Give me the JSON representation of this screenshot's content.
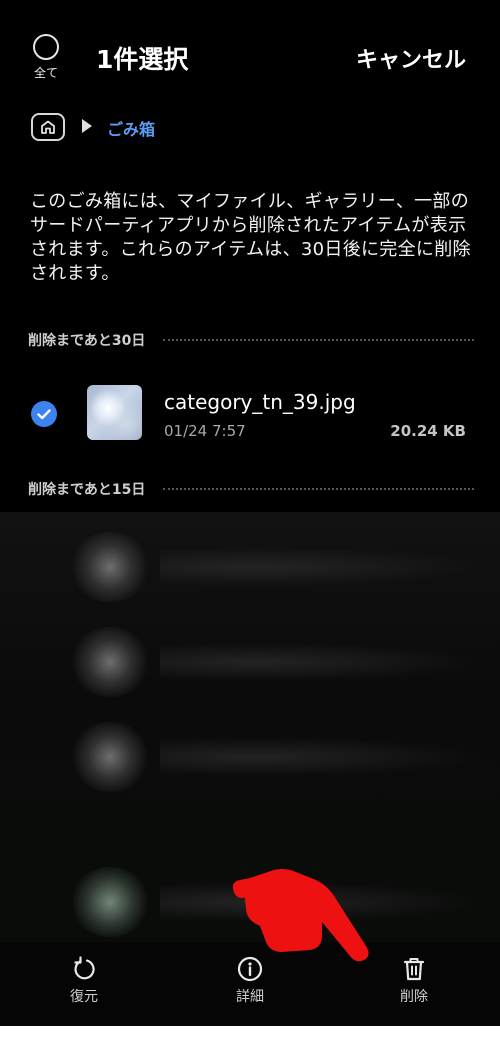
{
  "header": {
    "select_all_label": "全て",
    "title": "1件選択",
    "cancel_label": "キャンセル"
  },
  "breadcrumb": {
    "icon": "home-icon",
    "current": "ごみ箱"
  },
  "info_text": "このごみ箱には、マイファイル、ギャラリー、一部のサードパーティアプリから削除されたアイテムが表示されます。これらのアイテムは、30日後に完全に削除されます。",
  "sections": [
    {
      "label": "削除まであと30日"
    },
    {
      "label": "削除まであと15日"
    }
  ],
  "file": {
    "selected": true,
    "name": "category_tn_39.jpg",
    "date": "01/24 7:57",
    "size": "20.24 KB"
  },
  "bottom_nav": [
    {
      "label": "復元",
      "icon": "restore-icon"
    },
    {
      "label": "詳細",
      "icon": "info-icon"
    },
    {
      "label": "削除",
      "icon": "trash-icon"
    }
  ],
  "colors": {
    "accent": "#3c83f0",
    "breadcrumb": "#5d9cf5",
    "pointer": "#ee1111"
  }
}
